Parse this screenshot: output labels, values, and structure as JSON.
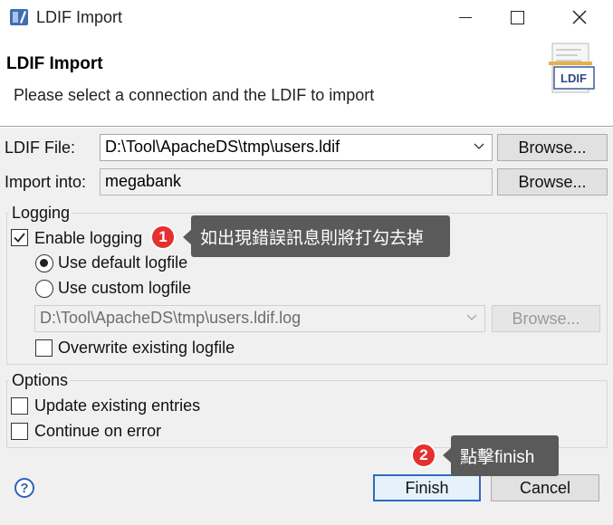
{
  "window": {
    "title": "LDIF Import",
    "minimize_icon": "minimize-icon",
    "maximize_icon": "maximize-icon",
    "close_icon": "close-icon"
  },
  "header": {
    "title": "LDIF Import",
    "description": "Please select a connection and the LDIF to import",
    "image_label": "LDIF"
  },
  "form": {
    "ldif_file_label": "LDIF File:",
    "ldif_file_value": "D:\\Tool\\ApacheDS\\tmp\\users.ldif",
    "browse_label": "Browse...",
    "import_into_label": "Import into:",
    "import_into_value": "megabank",
    "browse2_label": "Browse..."
  },
  "logging": {
    "legend": "Logging",
    "enable_logging_label": "Enable logging",
    "enable_logging_checked": true,
    "use_default_label": "Use default logfile",
    "use_custom_label": "Use custom logfile",
    "selected": "default",
    "logfile_value": "D:\\Tool\\ApacheDS\\tmp\\users.ldif.log",
    "browse_label": "Browse...",
    "overwrite_label": "Overwrite existing logfile",
    "overwrite_checked": false
  },
  "options": {
    "legend": "Options",
    "update_label": "Update existing entries",
    "update_checked": false,
    "continue_label": "Continue on error",
    "continue_checked": false
  },
  "annotations": {
    "step1_number": "1",
    "step1_text": "如出現錯誤訊息則將打勾去掉",
    "step2_number": "2",
    "step2_text": "點擊finish"
  },
  "footer": {
    "help_icon": "help-icon",
    "help_glyph": "?",
    "finish_label": "Finish",
    "cancel_label": "Cancel"
  },
  "colors": {
    "badge": "#e53030",
    "tooltip": "#5a5a5a",
    "default_button_border": "#2e6bc4"
  }
}
